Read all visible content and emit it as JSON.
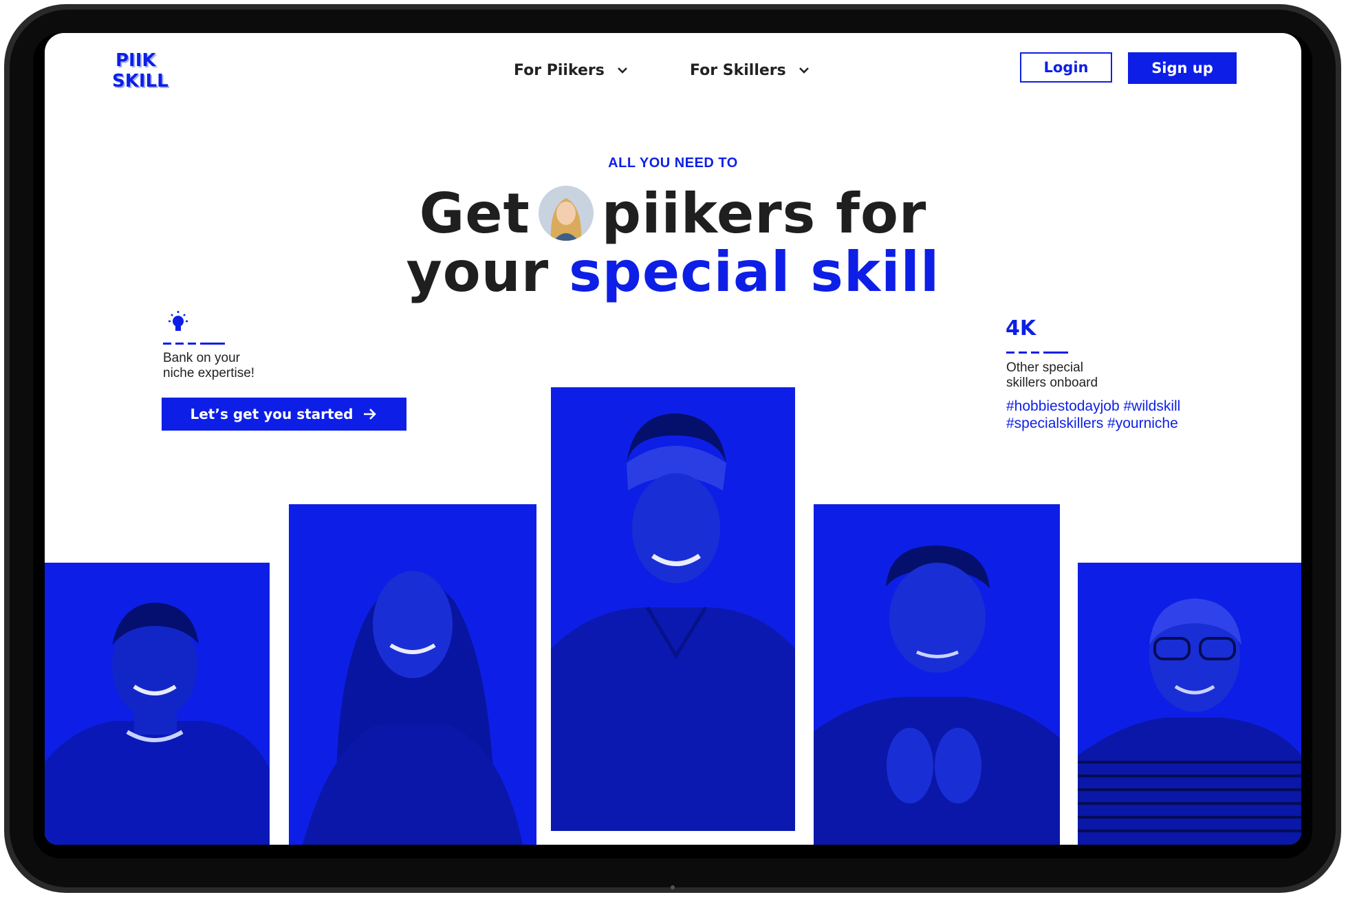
{
  "brand": {
    "logo_line1": "PIIK",
    "logo_line2": "SKILL",
    "accent_color": "#0d1fe6"
  },
  "nav": {
    "items": [
      {
        "label": "For Piikers",
        "icon": "chevron-down-icon"
      },
      {
        "label": "For Skillers",
        "icon": "chevron-down-icon"
      }
    ],
    "login_label": "Login",
    "signup_label": "Sign up"
  },
  "hero": {
    "eyebrow": "ALL YOU NEED TO",
    "line1_before": "Get",
    "line1_after": "piikers for",
    "line2_plain": "your",
    "line2_accent": "special skill"
  },
  "feature": {
    "icon": "lightbulb-icon",
    "text_line1": "Bank on your",
    "text_line2": "niche expertise!",
    "cta_label": "Let’s get you started",
    "cta_icon": "arrow-right-icon"
  },
  "stat": {
    "number": "4K",
    "text_line1": "Other special",
    "text_line2": "skillers onboard",
    "hashtags_line1": "#hobbiestodayjob #wildskill",
    "hashtags_line2": "#specialskillers #yourniche"
  },
  "people": [
    {
      "name": "person-photo-1"
    },
    {
      "name": "person-photo-2"
    },
    {
      "name": "person-photo-3"
    },
    {
      "name": "person-photo-4"
    },
    {
      "name": "person-photo-5"
    }
  ]
}
